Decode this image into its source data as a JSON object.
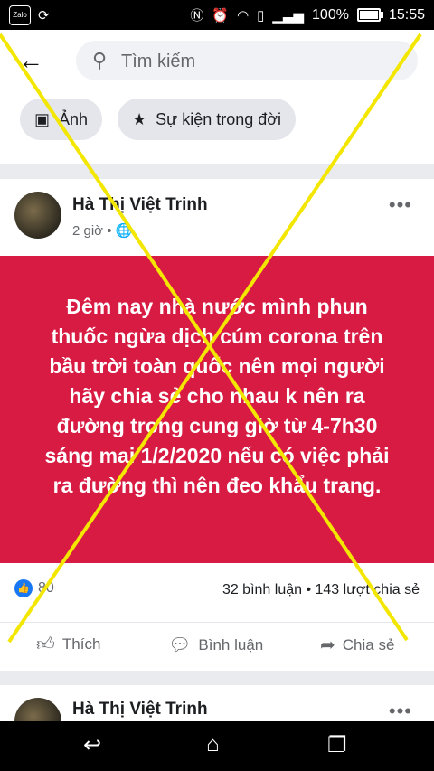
{
  "status_bar": {
    "app_icon": "Zalo",
    "battery": "100%",
    "time": "15:55"
  },
  "search": {
    "placeholder": "Tìm kiếm"
  },
  "chips": [
    {
      "label": "Ảnh"
    },
    {
      "label": "Sự kiện trong đời"
    }
  ],
  "post": {
    "author": "Hà Thị Việt Trinh",
    "time": "2 giờ",
    "text": "Đêm nay nhà nước mình phun thuốc ngừa dịch cúm corona trên bầu trời toàn quốc nên mọi người hãy chia sẻ cho nhau k nên ra đường trong cung giờ từ 4-7h30 sáng mai 1/2/2020 nếu có việc phải ra đường thì nên đeo khẩu trang.",
    "background_color": "#d81b43",
    "reactions": "80",
    "comments_shares": "32 bình luận • 143 lượt chia sẻ",
    "actions": {
      "like": "Thích",
      "comment": "Bình luận",
      "share": "Chia sẻ"
    }
  },
  "post2": {
    "author": "Hà Thị Việt Trinh"
  },
  "overlay_cross_color": "#f3e600"
}
